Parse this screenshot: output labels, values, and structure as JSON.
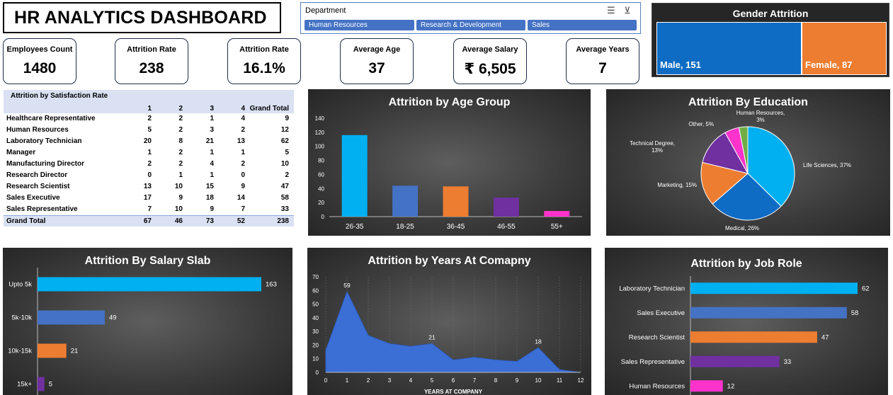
{
  "title": "HR ANALYTICS DASHBOARD",
  "slicer": {
    "header": "Department",
    "items": [
      "Human Resources",
      "Research & Development",
      "Sales"
    ]
  },
  "gender": {
    "title": "Gender Attrition",
    "male_label": "Male, 151",
    "female_label": "Female, 87",
    "male_value": 151,
    "female_value": 87,
    "colors": {
      "male": "#0e6cc4",
      "female": "#ed7d31"
    }
  },
  "kpis": [
    {
      "label": "Employees Count",
      "value": "1480"
    },
    {
      "label": "Attrition Rate",
      "value": "238"
    },
    {
      "label": "Attrition Rate",
      "value": "16.1%"
    },
    {
      "label": "Average Age",
      "value": "37"
    },
    {
      "label": "Average Salary",
      "value": "₹ 6,505"
    },
    {
      "label": "Average Years",
      "value": "7"
    }
  ],
  "pivot": {
    "title": "Attrition by Satisfaction Rate",
    "columns": [
      "1",
      "2",
      "3",
      "4",
      "Grand Total"
    ],
    "rows": [
      {
        "label": "Healthcare Representative",
        "values": [
          "2",
          "2",
          "1",
          "4",
          "9"
        ]
      },
      {
        "label": "Human Resources",
        "values": [
          "5",
          "2",
          "3",
          "2",
          "12"
        ]
      },
      {
        "label": "Laboratory Technician",
        "values": [
          "20",
          "8",
          "21",
          "13",
          "62"
        ]
      },
      {
        "label": "Manager",
        "values": [
          "1",
          "2",
          "1",
          "1",
          "5"
        ]
      },
      {
        "label": "Manufacturing Director",
        "values": [
          "2",
          "2",
          "4",
          "2",
          "10"
        ]
      },
      {
        "label": "Research Director",
        "values": [
          "0",
          "1",
          "1",
          "0",
          "2"
        ]
      },
      {
        "label": "Research Scientist",
        "values": [
          "13",
          "10",
          "15",
          "9",
          "47"
        ]
      },
      {
        "label": "Sales Executive",
        "values": [
          "17",
          "9",
          "18",
          "14",
          "58"
        ]
      },
      {
        "label": "Sales Representative",
        "values": [
          "7",
          "10",
          "9",
          "7",
          "33"
        ]
      }
    ],
    "total": {
      "label": "Grand Total",
      "values": [
        "67",
        "46",
        "73",
        "52",
        "238"
      ]
    }
  },
  "charts": {
    "age": {
      "title": "Attrition by Age Group"
    },
    "education": {
      "title": "Attrition By Education"
    },
    "salary": {
      "title": "Attrition By Salary Slab"
    },
    "years": {
      "title": "Attrition by Years At Comapny"
    },
    "jobrole": {
      "title": "Attrition by Job Role"
    }
  },
  "chart_data": [
    {
      "type": "bar",
      "title": "Attrition by Age Group",
      "categories": [
        "26-35",
        "18-25",
        "36-45",
        "46-55",
        "55+"
      ],
      "values": [
        116,
        44,
        43,
        27,
        8
      ],
      "colors": [
        "#00b0f0",
        "#4472c4",
        "#ed7d31",
        "#7030a0",
        "#ff33cc"
      ],
      "ylim": [
        0,
        140
      ],
      "yticks": [
        0,
        20,
        40,
        60,
        80,
        100,
        120,
        140
      ]
    },
    {
      "type": "pie",
      "title": "Attrition By Education",
      "slices": [
        {
          "label": "Life Sciences, 37%",
          "value": 37,
          "color": "#00b0f0"
        },
        {
          "label": "Medical, 26%",
          "value": 26,
          "color": "#0e6cc4"
        },
        {
          "label": "Marketing, 15%",
          "value": 15,
          "color": "#ed7d31"
        },
        {
          "label": "Technical Degree, 13%",
          "value": 13,
          "color": "#7030a0"
        },
        {
          "label": "Other, 5%",
          "value": 5,
          "color": "#ff33cc"
        },
        {
          "label": "Human Resources, 3%",
          "value": 3,
          "color": "#70ad47"
        }
      ]
    },
    {
      "type": "bar",
      "orientation": "horizontal",
      "title": "Attrition By Salary Slab",
      "categories": [
        "Upto 5k",
        "5k-10k",
        "10k-15k",
        "15k+"
      ],
      "values": [
        163,
        49,
        21,
        5
      ],
      "colors": [
        "#00b0f0",
        "#4472c4",
        "#ed7d31",
        "#7030a0"
      ]
    },
    {
      "type": "area",
      "title": "Attrition by Years At Comapny",
      "xlabel": "YEARS AT COMPANY",
      "x": [
        0,
        1,
        2,
        3,
        4,
        5,
        6,
        7,
        8,
        9,
        10,
        11,
        12
      ],
      "values": [
        16,
        59,
        27,
        21,
        19,
        21,
        9,
        11,
        9,
        8,
        18,
        2,
        0
      ],
      "labeled": [
        {
          "x": 1,
          "label": "59"
        },
        {
          "x": 5,
          "label": "21"
        },
        {
          "x": 10,
          "label": "18"
        }
      ],
      "ylim": [
        0,
        70
      ],
      "yticks": [
        0,
        10,
        20,
        30,
        40,
        50,
        60,
        70
      ],
      "color": "#3b6fd6"
    },
    {
      "type": "bar",
      "orientation": "horizontal",
      "title": "Attrition by Job Role",
      "categories": [
        "Laboratory Technician",
        "Sales Executive",
        "Research Scientist",
        "Sales Representative",
        "Human Resources"
      ],
      "values": [
        62,
        58,
        47,
        33,
        12
      ],
      "colors": [
        "#00b0f0",
        "#4472c4",
        "#ed7d31",
        "#7030a0",
        "#ff33cc"
      ]
    }
  ]
}
